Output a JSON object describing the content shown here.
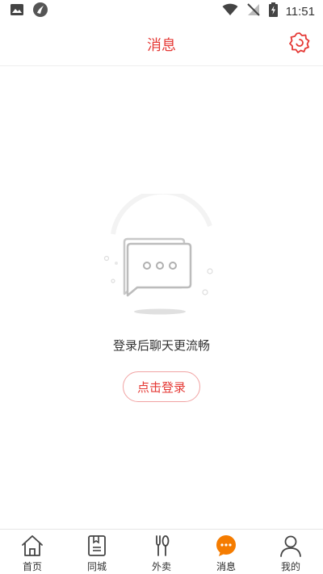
{
  "status_bar": {
    "time": "11:51",
    "icons_left": [
      "image-icon",
      "app-logo-icon"
    ],
    "icons_right": [
      "wifi-icon",
      "no-signal-icon",
      "battery-charging-icon"
    ]
  },
  "header": {
    "title": "消息",
    "settings_icon": "gear-icon"
  },
  "empty_state": {
    "message": "登录后聊天更流畅",
    "login_label": "点击登录"
  },
  "bottom_nav": {
    "items": [
      {
        "label": "首页",
        "icon": "home-icon"
      },
      {
        "label": "同城",
        "icon": "book-icon"
      },
      {
        "label": "外卖",
        "icon": "utensils-icon"
      },
      {
        "label": "消息",
        "icon": "chat-bubble-icon",
        "active": true
      },
      {
        "label": "我的",
        "icon": "user-icon"
      }
    ]
  },
  "colors": {
    "accent": "#e53935",
    "active_nav": "#f57c00",
    "divider": "#eeeeee"
  }
}
